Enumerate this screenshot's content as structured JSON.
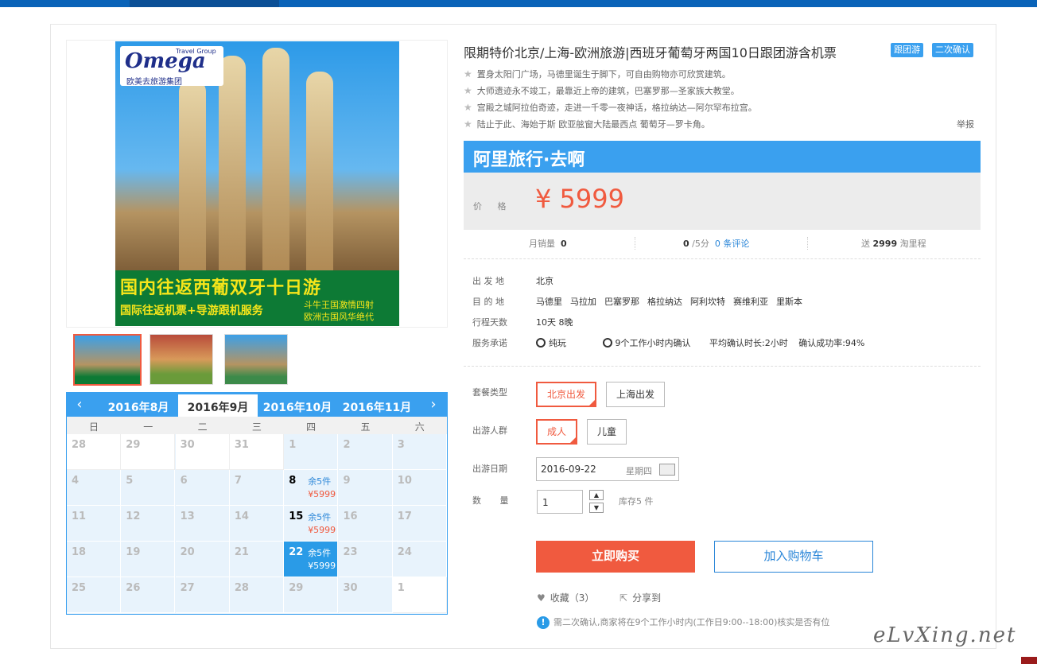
{
  "product": {
    "title": "限期特价北京/上海-欧洲旅游|西班牙葡萄牙两国10日跟团游含机票",
    "tags": [
      "跟团游",
      "二次确认"
    ],
    "features": [
      "置身太阳门广场，马德里诞生于脚下，可自由购物亦可欣赏建筑。",
      "大师遗迹永不竣工，最靠近上帝的建筑，巴塞罗那—圣家族大教堂。",
      "宫殿之城阿拉伯奇迹，走进一千零一夜神话，格拉纳达—阿尔罕布拉宫。",
      "陆止于此、海始于斯 欧亚舷窗大陆最西点 葡萄牙—罗卡角。"
    ],
    "report": "举报"
  },
  "poster": {
    "logo_word": "Omega",
    "logo_tag": "Travel Group",
    "logo_cn": "欧美去旅游集团",
    "headline": "国内往返西葡双牙十日游",
    "subline": "国际往返机票+导游跟机服务",
    "side1": "斗牛王国激情四射",
    "side2": "欧洲古国风华绝代"
  },
  "price_box": {
    "brand": "阿里旅行·去啊",
    "price_label": "价 格",
    "price": "¥ 5999"
  },
  "stats": {
    "monthly_label": "月销量",
    "monthly_value": "0",
    "rating_value": "0",
    "rating_suffix": "/5分",
    "reviews": "0 条评论",
    "points_prefix": "送",
    "points_value": "2999",
    "points_suffix": "淘里程"
  },
  "info": {
    "depart_label": "出 发 地",
    "depart_value": "北京",
    "dest_label": "目 的 地",
    "dest_values": [
      "马德里",
      "马拉加",
      "巴塞罗那",
      "格拉纳达",
      "阿利坎特",
      "赛维利亚",
      "里斯本"
    ],
    "days_label": "行程天数",
    "days_value": "10天 8晚",
    "promise_label": "服务承诺",
    "promise_1": "纯玩",
    "promise_2": "9个工作小时内确认",
    "promise_3": "平均确认时长:2小时",
    "promise_4": "确认成功率:94%"
  },
  "form": {
    "package_label": "套餐类型",
    "package_options": [
      "北京出发",
      "上海出发"
    ],
    "crowd_label": "出游人群",
    "crowd_options": [
      "成人",
      "儿童"
    ],
    "date_label": "出游日期",
    "date_value": "2016-09-22",
    "weekday": "星期四",
    "qty_label": "数 量",
    "qty_value": "1",
    "stock": "库存5 件",
    "buy_label": "立即购买",
    "cart_label": "加入购物车",
    "fav_label": "收藏（3）",
    "share_label": "分享到",
    "notice": "需二次确认,商家将在9个工作小时内(工作日9:00--18:00)核实是否有位"
  },
  "calendar": {
    "months": [
      "2016年8月",
      "2016年9月",
      "2016年10月",
      "2016年11月"
    ],
    "weekdays": [
      "日",
      "一",
      "二",
      "三",
      "四",
      "五",
      "六"
    ],
    "weeks": [
      [
        {
          "d": "28",
          "out": true
        },
        {
          "d": "29",
          "out": true
        },
        {
          "d": "30",
          "out": true
        },
        {
          "d": "31",
          "out": true
        },
        {
          "d": "1"
        },
        {
          "d": "2"
        },
        {
          "d": "3"
        }
      ],
      [
        {
          "d": "4"
        },
        {
          "d": "5"
        },
        {
          "d": "6"
        },
        {
          "d": "7"
        },
        {
          "d": "8",
          "stock": "余5件",
          "price": "¥5999"
        },
        {
          "d": "9"
        },
        {
          "d": "10"
        }
      ],
      [
        {
          "d": "11"
        },
        {
          "d": "12"
        },
        {
          "d": "13"
        },
        {
          "d": "14"
        },
        {
          "d": "15",
          "stock": "余5件",
          "price": "¥5999"
        },
        {
          "d": "16"
        },
        {
          "d": "17"
        }
      ],
      [
        {
          "d": "18"
        },
        {
          "d": "19"
        },
        {
          "d": "20"
        },
        {
          "d": "21"
        },
        {
          "d": "22",
          "stock": "余5件",
          "price": "¥5999",
          "picked": true
        },
        {
          "d": "23"
        },
        {
          "d": "24"
        }
      ],
      [
        {
          "d": "25"
        },
        {
          "d": "26"
        },
        {
          "d": "27"
        },
        {
          "d": "28"
        },
        {
          "d": "29"
        },
        {
          "d": "30"
        },
        {
          "d": "1",
          "out": true
        }
      ]
    ]
  },
  "watermark": "eLvXing.net",
  "colors": {
    "accent": "#3aa0ef",
    "price": "#f05a3f",
    "nav": "#0a63b8"
  }
}
